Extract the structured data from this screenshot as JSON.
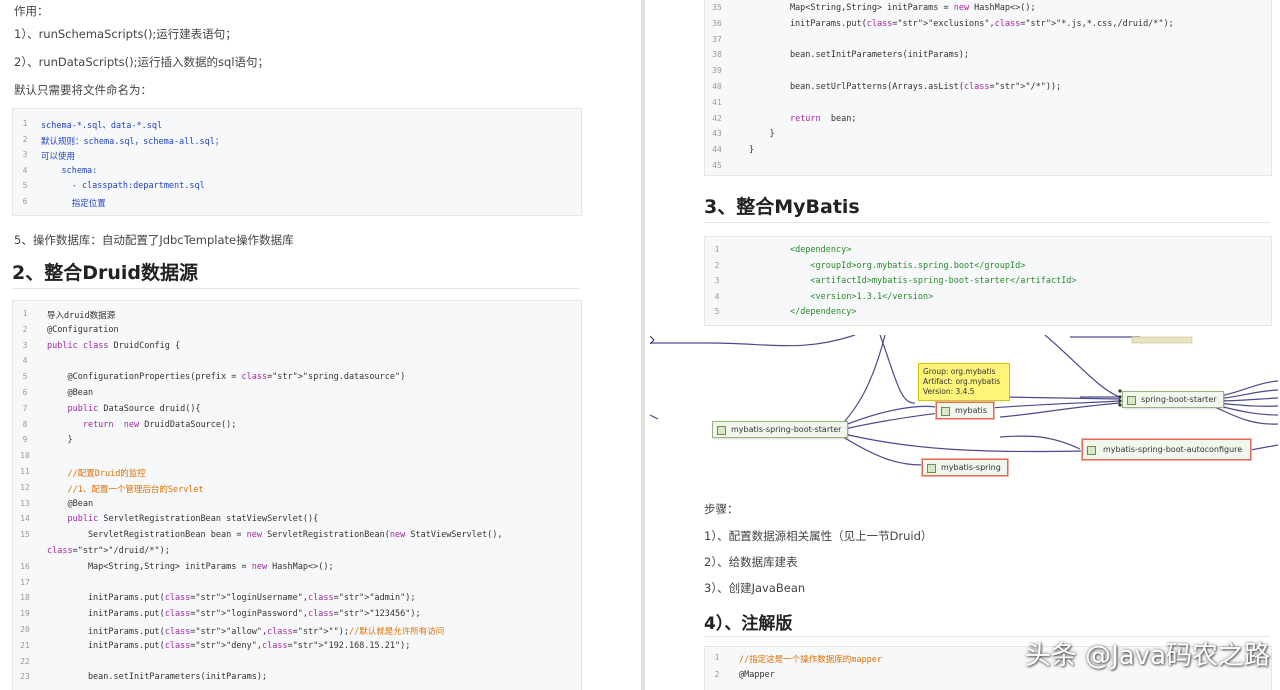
{
  "left": {
    "intro": {
      "line0": "作用：",
      "line1": "1）、runSchemaScripts();运行建表语句；",
      "line2": "2）、runDataScripts();运行插入数据的sql语句；",
      "line3": "默认只需要将文件命名为："
    },
    "code1": [
      {
        "n": "1",
        "t": "schema-*.sql、data-*.sql"
      },
      {
        "n": "2",
        "t": "默认规则：schema.sql，schema-all.sql；"
      },
      {
        "n": "3",
        "t": "可以使用"
      },
      {
        "n": "4",
        "t": "    schema:"
      },
      {
        "n": "5",
        "t": "      - classpath:department.sql"
      },
      {
        "n": "6",
        "t": "      指定位置"
      }
    ],
    "step5": "5、操作数据库：自动配置了JdbcTemplate操作数据库",
    "heading": "2、整合Druid数据源",
    "code2": [
      {
        "n": "1",
        "t": "导入druid数据源"
      },
      {
        "n": "2",
        "t": "@Configuration"
      },
      {
        "n": "3",
        "t": "public class DruidConfig {"
      },
      {
        "n": "4",
        "t": ""
      },
      {
        "n": "5",
        "t": "    @ConfigurationProperties(prefix = \"spring.datasource\")"
      },
      {
        "n": "6",
        "t": "    @Bean"
      },
      {
        "n": "7",
        "t": "    public DataSource druid(){"
      },
      {
        "n": "8",
        "t": "       return  new DruidDataSource();"
      },
      {
        "n": "9",
        "t": "    }"
      },
      {
        "n": "10",
        "t": ""
      },
      {
        "n": "11",
        "t": "    //配置Druid的监控"
      },
      {
        "n": "12",
        "t": "    //1、配置一个管理后台的Servlet"
      },
      {
        "n": "13",
        "t": "    @Bean"
      },
      {
        "n": "14",
        "t": "    public ServletRegistrationBean statViewServlet(){"
      },
      {
        "n": "15",
        "t": "        ServletRegistrationBean bean = new ServletRegistrationBean(new StatViewServlet(),"
      },
      {
        "n": "",
        "t": "\"/druid/*\");"
      },
      {
        "n": "16",
        "t": "        Map<String,String> initParams = new HashMap<>();"
      },
      {
        "n": "17",
        "t": ""
      },
      {
        "n": "18",
        "t": "        initParams.put(\"loginUsername\",\"admin\");"
      },
      {
        "n": "19",
        "t": "        initParams.put(\"loginPassword\",\"123456\");"
      },
      {
        "n": "20",
        "t": "        initParams.put(\"allow\",\"\");//默认就是允许所有访问"
      },
      {
        "n": "21",
        "t": "        initParams.put(\"deny\",\"192.168.15.21\");"
      },
      {
        "n": "22",
        "t": ""
      },
      {
        "n": "23",
        "t": "        bean.setInitParameters(initParams);"
      }
    ]
  },
  "right": {
    "code3": [
      {
        "n": "35",
        "t": "        Map<String,String> initParams = new HashMap<>();"
      },
      {
        "n": "36",
        "t": "        initParams.put(\"exclusions\",\"*.js,*.css,/druid/*\");"
      },
      {
        "n": "37",
        "t": ""
      },
      {
        "n": "38",
        "t": "        bean.setInitParameters(initParams);"
      },
      {
        "n": "39",
        "t": ""
      },
      {
        "n": "40",
        "t": "        bean.setUrlPatterns(Arrays.asList(\"/*\"));"
      },
      {
        "n": "41",
        "t": ""
      },
      {
        "n": "42",
        "t": "        return  bean;"
      },
      {
        "n": "43",
        "t": "    }"
      },
      {
        "n": "44",
        "t": "}"
      },
      {
        "n": "45",
        "t": ""
      }
    ],
    "heading3": "3、整合MyBatis",
    "code4": [
      {
        "n": "1",
        "t": "        <dependency>"
      },
      {
        "n": "2",
        "t": "            <groupId>org.mybatis.spring.boot</groupId>"
      },
      {
        "n": "3",
        "t": "            <artifactId>mybatis-spring-boot-starter</artifactId>"
      },
      {
        "n": "4",
        "t": "            <version>1.3.1</version>"
      },
      {
        "n": "5",
        "t": "        </dependency>"
      }
    ],
    "diagram": {
      "note": [
        "Group: org.mybatis",
        "Artifact: org.mybatis",
        "Version: 3.4.5"
      ],
      "node_left": "mybatis-spring-boot-starter",
      "node_mid": "mybatis",
      "node_right": "spring-boot-starter",
      "node_auto": "mybatis-spring-boot-autoconfigure",
      "node_spring": "mybatis-spring"
    },
    "steps_title": "步骤：",
    "step1": "1）、配置数据源相关属性（见上一节Druid）",
    "step2": "2）、给数据库建表",
    "step3": "3）、创建JavaBean",
    "heading4": "4）、注解版",
    "code5": [
      {
        "n": "1",
        "t": "//指定这是一个操作数据库的mapper"
      },
      {
        "n": "2",
        "t": "@Mapper"
      }
    ]
  },
  "watermark": "头条 @Java码农之路",
  "colors": {
    "keyword": "#a626a4",
    "string": "#dd1144",
    "comment": "#e07000",
    "tag": "#2a8a2a",
    "note_bg": "#fff47a",
    "node_border": "#9ab37e",
    "node_red": "#e06a5a"
  }
}
